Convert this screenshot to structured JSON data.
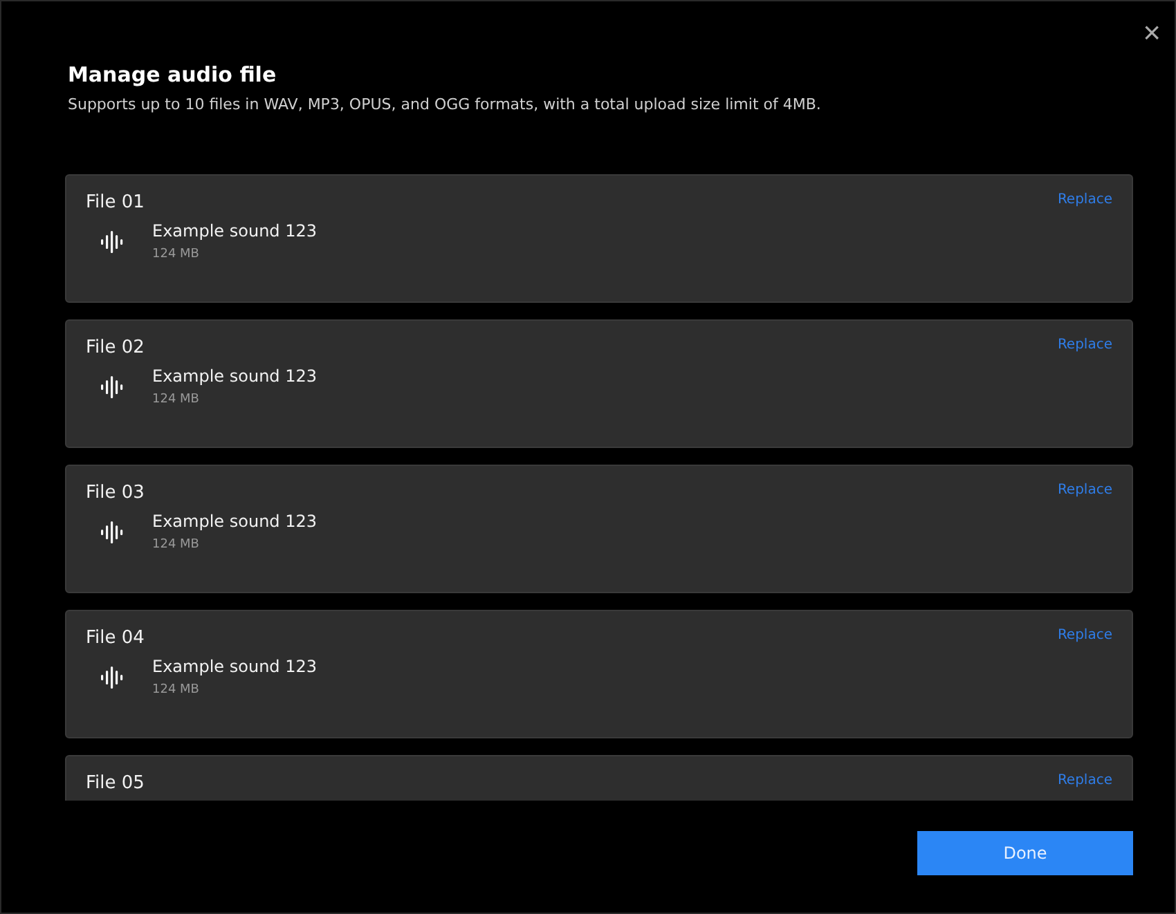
{
  "dialog": {
    "title": "Manage audio file",
    "description": "Supports up to 10 files in WAV, MP3, OPUS, and OGG formats, with a total upload size limit of 4MB.",
    "close": "×"
  },
  "files": [
    {
      "label": "File 01",
      "action": "Replace",
      "name": "Example sound 123",
      "size": "124 MB"
    },
    {
      "label": "File 02",
      "action": "Replace",
      "name": "Example sound 123",
      "size": "124 MB"
    },
    {
      "label": "File 03",
      "action": "Replace",
      "name": "Example sound 123",
      "size": "124 MB"
    },
    {
      "label": "File 04",
      "action": "Replace",
      "name": "Example sound 123",
      "size": "124 MB"
    },
    {
      "label": "File 05",
      "action": "Replace"
    }
  ],
  "buttons": [
    "Done"
  ]
}
